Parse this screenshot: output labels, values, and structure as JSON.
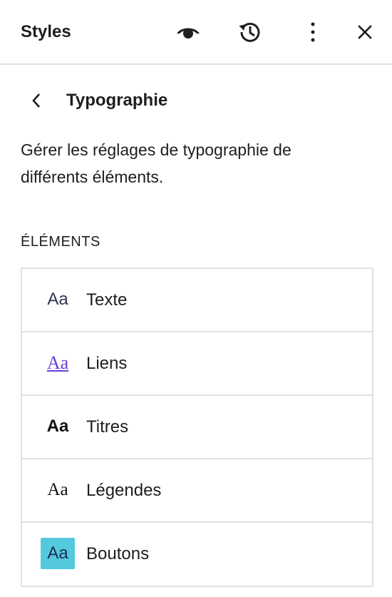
{
  "header": {
    "title": "Styles",
    "icons": {
      "preview": "eye-icon",
      "revisions": "history-icon",
      "more": "more-vertical-icon",
      "close": "close-icon"
    }
  },
  "nav": {
    "back_icon": "chevron-left-icon",
    "title": "Typographie"
  },
  "description": "Gérer les réglages de typographie de différents éléments.",
  "elements": {
    "heading": "Éléments",
    "items": [
      {
        "preview": "Aa",
        "label": "Texte"
      },
      {
        "preview": "Aa",
        "label": "Liens"
      },
      {
        "preview": "Aa",
        "label": "Titres"
      },
      {
        "preview": "Aa",
        "label": "Légendes"
      },
      {
        "preview": "Aa",
        "label": "Boutons"
      }
    ]
  },
  "colors": {
    "text": "#1e1e1e",
    "border": "#e0e0e0",
    "link_preview": "#6b3fd6",
    "button_preview_bg": "#54c9dd"
  }
}
